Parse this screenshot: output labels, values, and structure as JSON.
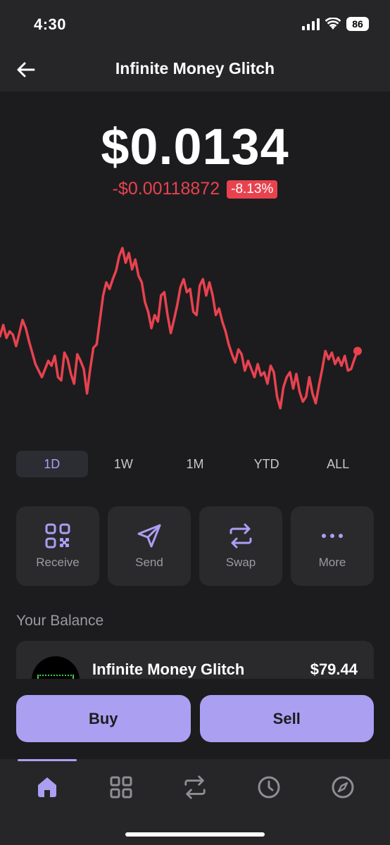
{
  "status": {
    "time": "4:30",
    "battery": "86"
  },
  "header": {
    "title": "Infinite Money Glitch"
  },
  "price": {
    "value": "$0.0134",
    "change_amount": "-$0.00118872",
    "change_percent": "-8.13%"
  },
  "colors": {
    "accent": "#ab9ff2",
    "negative": "#e8424f",
    "background": "#1c1c1e",
    "card": "#2a2a2d"
  },
  "chart_data": {
    "type": "line",
    "series": [
      {
        "values": [
          0.45,
          0.52,
          0.44,
          0.48,
          0.46,
          0.39,
          0.47,
          0.55,
          0.5,
          0.42,
          0.35,
          0.28,
          0.24,
          0.2,
          0.25,
          0.3,
          0.27,
          0.33,
          0.2,
          0.18,
          0.35,
          0.31,
          0.22,
          0.16,
          0.34,
          0.3,
          0.25,
          0.1,
          0.25,
          0.38,
          0.4,
          0.55,
          0.7,
          0.78,
          0.74,
          0.8,
          0.85,
          0.94,
          0.99,
          0.9,
          0.96,
          0.86,
          0.92,
          0.82,
          0.78,
          0.66,
          0.6,
          0.5,
          0.58,
          0.54,
          0.7,
          0.72,
          0.58,
          0.47,
          0.55,
          0.64,
          0.75,
          0.8,
          0.72,
          0.74,
          0.6,
          0.58,
          0.76,
          0.8,
          0.7,
          0.78,
          0.7,
          0.58,
          0.62,
          0.54,
          0.48,
          0.4,
          0.34,
          0.29,
          0.37,
          0.34,
          0.24,
          0.3,
          0.25,
          0.2,
          0.28,
          0.21,
          0.23,
          0.16,
          0.27,
          0.23,
          0.08,
          0.01,
          0.14,
          0.2,
          0.23,
          0.13,
          0.22,
          0.11,
          0.05,
          0.08,
          0.2,
          0.1,
          0.04,
          0.15,
          0.25,
          0.36,
          0.31,
          0.35,
          0.28,
          0.32,
          0.27,
          0.33,
          0.24,
          0.25,
          0.31,
          0.36
        ]
      }
    ],
    "last_point_marker": true
  },
  "ranges": [
    {
      "label": "1D",
      "active": true
    },
    {
      "label": "1W",
      "active": false
    },
    {
      "label": "1M",
      "active": false
    },
    {
      "label": "YTD",
      "active": false
    },
    {
      "label": "ALL",
      "active": false
    }
  ],
  "actions": [
    {
      "label": "Receive",
      "icon": "qr-code-icon"
    },
    {
      "label": "Send",
      "icon": "paper-plane-icon"
    },
    {
      "label": "Swap",
      "icon": "swap-arrows-icon"
    },
    {
      "label": "More",
      "icon": "more-dots-icon"
    }
  ],
  "balance": {
    "section_title": "Your Balance",
    "token_name": "Infinite Money Glitch",
    "token_value": "$79.44"
  },
  "trade": {
    "buy_label": "Buy",
    "sell_label": "Sell"
  },
  "tabbar": {
    "items": [
      "home-icon",
      "grid-icon",
      "swap-icon",
      "clock-icon",
      "compass-icon"
    ],
    "active": 0
  }
}
